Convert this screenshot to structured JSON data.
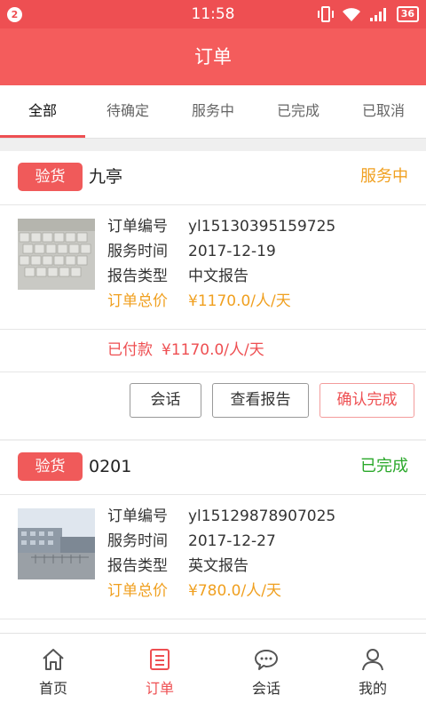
{
  "statusbar": {
    "notification_count": "2",
    "time": "11:58",
    "battery": "36"
  },
  "title": "订单",
  "tabs": [
    {
      "label": "全部"
    },
    {
      "label": "待确定"
    },
    {
      "label": "服务中"
    },
    {
      "label": "已完成"
    },
    {
      "label": "已取消"
    }
  ],
  "orders": [
    {
      "tag": "验货",
      "shop": "九亭",
      "status": "服务中",
      "labels": {
        "order_no": "订单编号",
        "service_time": "服务时间",
        "report_type": "报告类型",
        "total": "订单总价"
      },
      "order_no": "yl15130395159725",
      "service_time": "2017-12-19",
      "report_type": "中文报告",
      "total": "¥1170.0/人/天",
      "paid_label": "已付款",
      "paid_amount": "¥1170.0/人/天",
      "buttons": {
        "chat": "会话",
        "view_report": "查看报告",
        "confirm": "确认完成"
      }
    },
    {
      "tag": "验货",
      "shop": "0201",
      "status": "已完成",
      "labels": {
        "order_no": "订单编号",
        "service_time": "服务时间",
        "report_type": "报告类型",
        "total": "订单总价"
      },
      "order_no": "yl15129878907025",
      "service_time": "2017-12-27",
      "report_type": "英文报告",
      "total": "¥780.0/人/天"
    }
  ],
  "nav": [
    {
      "label": "首页",
      "icon": "home-icon"
    },
    {
      "label": "订单",
      "icon": "order-icon"
    },
    {
      "label": "会话",
      "icon": "chat-icon"
    },
    {
      "label": "我的",
      "icon": "user-icon"
    }
  ],
  "colors": {
    "brand": "#f45c5c",
    "status_orange": "#f0a020",
    "status_green": "#2aa82a"
  }
}
